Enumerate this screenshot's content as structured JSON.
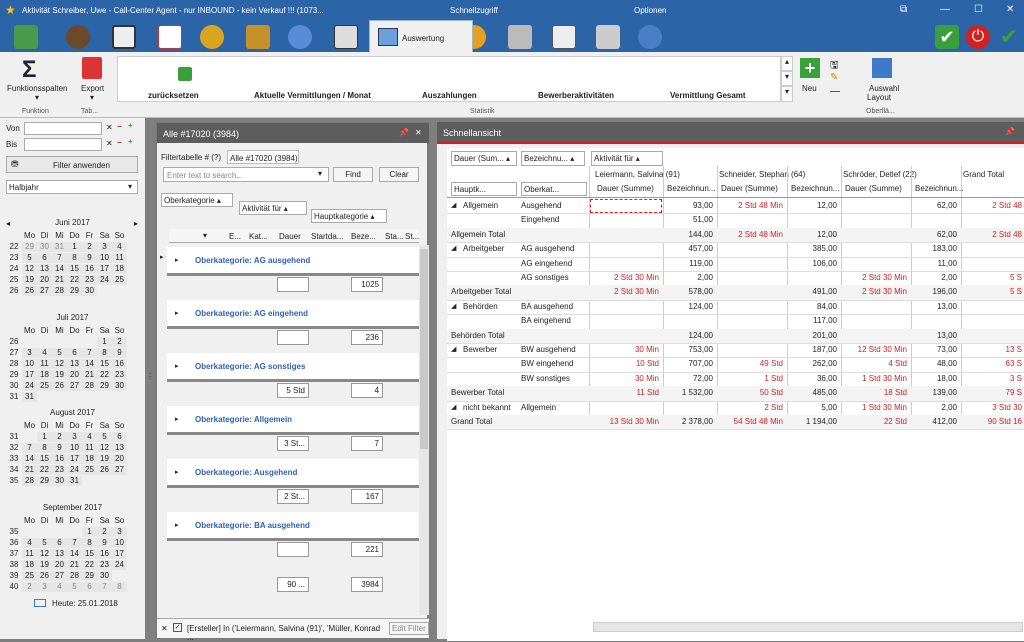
{
  "titlebar": {
    "title": "Aktivität Schreiber, Uwe - Call-Center Agent - nur INBOUND - kein Verkauf !!! (1073...",
    "quick_access": "Schnellzugriff",
    "options": "Optionen"
  },
  "main_tab": {
    "label": "Auswertung"
  },
  "ribbon": {
    "funktionsspalten": "Funktionsspalten",
    "funktion_group": "Funktion",
    "export": "Export",
    "tab_group": "Tab...",
    "gallery_items": [
      "zurücksetzen",
      "Aktuelle Vermittlungen / Monat",
      "Auszahlungen",
      "Bewerberaktivitäten",
      "Vermittlung Gesamt"
    ],
    "statistik_group": "Statistik",
    "neu": "Neu",
    "auswahl_layout": "Auswahl",
    "auswahl_layout2": "Layout",
    "oberflaeche_group": "Oberflä..."
  },
  "left": {
    "von": "Von",
    "bis": "Bis",
    "filter_button": "Filter anwenden",
    "period": "Halbjahr",
    "weekday_headers": [
      "Mo",
      "Di",
      "Mi",
      "Do",
      "Fr",
      "Sa",
      "So"
    ],
    "today_label": "Heute: 25.01.2018",
    "months": [
      {
        "title": "Juni 2017",
        "rows": [
          [
            "22",
            "29",
            "30",
            "31",
            "1",
            "2",
            "3",
            "4"
          ],
          [
            "23",
            "5",
            "6",
            "7",
            "8",
            "9",
            "10",
            "11"
          ],
          [
            "24",
            "12",
            "13",
            "14",
            "15",
            "16",
            "17",
            "18"
          ],
          [
            "25",
            "19",
            "20",
            "21",
            "22",
            "23",
            "24",
            "25"
          ],
          [
            "26",
            "26",
            "27",
            "28",
            "29",
            "30",
            "",
            ""
          ]
        ]
      },
      {
        "title": "Juli 2017",
        "rows": [
          [
            "26",
            "",
            "",
            "",
            "",
            "",
            "1",
            "2"
          ],
          [
            "27",
            "3",
            "4",
            "5",
            "6",
            "7",
            "8",
            "9"
          ],
          [
            "28",
            "10",
            "11",
            "12",
            "13",
            "14",
            "15",
            "16"
          ],
          [
            "29",
            "17",
            "18",
            "19",
            "20",
            "21",
            "22",
            "23"
          ],
          [
            "30",
            "24",
            "25",
            "26",
            "27",
            "28",
            "29",
            "30"
          ],
          [
            "31",
            "31",
            "",
            "",
            "",
            "",
            "",
            ""
          ]
        ]
      },
      {
        "title": "August 2017",
        "rows": [
          [
            "31",
            "",
            "1",
            "2",
            "3",
            "4",
            "5",
            "6"
          ],
          [
            "32",
            "7",
            "8",
            "9",
            "10",
            "11",
            "12",
            "13"
          ],
          [
            "33",
            "14",
            "15",
            "16",
            "17",
            "18",
            "19",
            "20"
          ],
          [
            "34",
            "21",
            "22",
            "23",
            "24",
            "25",
            "26",
            "27"
          ],
          [
            "35",
            "28",
            "29",
            "30",
            "31",
            "",
            "",
            ""
          ]
        ]
      },
      {
        "title": "September 2017",
        "rows": [
          [
            "35",
            "",
            "",
            "",
            "",
            "1",
            "2",
            "3"
          ],
          [
            "36",
            "4",
            "5",
            "6",
            "7",
            "8",
            "9",
            "10"
          ],
          [
            "37",
            "11",
            "12",
            "13",
            "14",
            "15",
            "16",
            "17"
          ],
          [
            "38",
            "18",
            "19",
            "20",
            "21",
            "22",
            "23",
            "24"
          ],
          [
            "39",
            "25",
            "26",
            "27",
            "28",
            "29",
            "30",
            ""
          ],
          [
            "40",
            "2",
            "3",
            "4",
            "5",
            "6",
            "7",
            "8"
          ]
        ]
      }
    ]
  },
  "grid": {
    "header": "Alle #17020 (3984)",
    "filter_label": "Filtertabelle # (?)",
    "filter_tab": "Alle #17020 (3984)",
    "search_placeholder": "Enter text to search...",
    "find": "Find",
    "clear": "Clear",
    "group_chips": [
      "Oberkategorie",
      "Aktivität für",
      "Hauptkategorie"
    ],
    "columns": [
      "E...",
      "Kat...",
      "Dauer",
      "Startda...",
      "Beze...",
      "Sta...",
      "St..."
    ],
    "groups": [
      {
        "label": "Oberkategorie: AG ausgehend",
        "dauer": "",
        "count": "1025"
      },
      {
        "label": "Oberkategorie: AG eingehend",
        "dauer": "",
        "count": "236"
      },
      {
        "label": "Oberkategorie: AG sonstiges",
        "dauer": "5 Std",
        "count": "4"
      },
      {
        "label": "Oberkategorie: Allgemein",
        "dauer": "3 St...",
        "count": "7"
      },
      {
        "label": "Oberkategorie: Ausgehend",
        "dauer": "2 St...",
        "count": "167"
      },
      {
        "label": "Oberkategorie: BA ausgehend",
        "dauer": "",
        "count": "221"
      }
    ],
    "total_dauer": "90 ...",
    "total_count": "3984",
    "filter_text": "[Ersteller] In ('Leiermann, Salvina (91)', 'Müller, Konrad ...",
    "edit_filter": "Edit Filter"
  },
  "quick": {
    "header": "Schnellansicht",
    "filter_chips": [
      "Dauer (Sum...",
      "Bezeichnu...",
      "Aktivität für"
    ],
    "row_chips": [
      "Hauptk...",
      "Oberkat..."
    ],
    "col_groups": [
      "Leiermann, Salvina (91)",
      "Schneider, Stephan (64)",
      "Schröder, Detlef (22)",
      "Grand Total"
    ],
    "sub_cols": [
      "Dauer (Summe)",
      "Bezeichnun..."
    ],
    "rows": [
      {
        "h": "Allgemein",
        "o": "Ausgehend",
        "c": [
          "",
          "93,00",
          "2 Std 48 Min",
          "12,00",
          "",
          "62,00",
          "2 Std 48"
        ],
        "exp": true
      },
      {
        "h": "",
        "o": "Eingehend",
        "c": [
          "",
          "51,00",
          "",
          "",
          "",
          "",
          ""
        ]
      },
      {
        "h": "Allgemein Total",
        "o": "",
        "c": [
          "",
          "144,00",
          "2 Std 48 Min",
          "12,00",
          "",
          "62,00",
          "2 Std 48"
        ],
        "total": true
      },
      {
        "h": "Arbeitgeber",
        "o": "AG ausgehend",
        "c": [
          "",
          "457,00",
          "",
          "385,00",
          "",
          "183,00",
          ""
        ],
        "exp": true
      },
      {
        "h": "",
        "o": "AG eingehend",
        "c": [
          "",
          "119,00",
          "",
          "106,00",
          "",
          "11,00",
          ""
        ]
      },
      {
        "h": "",
        "o": "AG sonstiges",
        "c": [
          "2 Std 30 Min",
          "2,00",
          "",
          "",
          "2 Std 30 Min",
          "2,00",
          "5 S"
        ]
      },
      {
        "h": "Arbeitgeber Total",
        "o": "",
        "c": [
          "2 Std 30 Min",
          "578,00",
          "",
          "491,00",
          "2 Std 30 Min",
          "196,00",
          "5 S"
        ],
        "total": true
      },
      {
        "h": "Behörden",
        "o": "BA ausgehend",
        "c": [
          "",
          "124,00",
          "",
          "84,00",
          "",
          "13,00",
          ""
        ],
        "exp": true
      },
      {
        "h": "",
        "o": "BA eingehend",
        "c": [
          "",
          "",
          "",
          "117,00",
          "",
          "",
          ""
        ]
      },
      {
        "h": "Behörden Total",
        "o": "",
        "c": [
          "",
          "124,00",
          "",
          "201,00",
          "",
          "13,00",
          ""
        ],
        "total": true
      },
      {
        "h": "Bewerber",
        "o": "BW ausgehend",
        "c": [
          "30 Min",
          "753,00",
          "",
          "187,00",
          "12 Std 30 Min",
          "73,00",
          "13 S"
        ],
        "exp": true
      },
      {
        "h": "",
        "o": "BW eingehend",
        "c": [
          "10 Std",
          "707,00",
          "49 Std",
          "262,00",
          "4 Std",
          "48,00",
          "63 S"
        ]
      },
      {
        "h": "",
        "o": "BW sonstiges",
        "c": [
          "30 Min",
          "72,00",
          "1 Std",
          "36,00",
          "1 Std 30 Min",
          "18,00",
          "3 S"
        ]
      },
      {
        "h": "Bewerber Total",
        "o": "",
        "c": [
          "11 Std",
          "1 532,00",
          "50 Std",
          "485,00",
          "18 Std",
          "139,00",
          "79 S"
        ],
        "total": true
      },
      {
        "h": "nicht bekannt",
        "o": "Allgemein",
        "c": [
          "",
          "",
          "2 Std",
          "5,00",
          "1 Std 30 Min",
          "2,00",
          "3 Std 30"
        ],
        "exp": true
      },
      {
        "h": "Grand Total",
        "o": "",
        "c": [
          "13 Std 30 Min",
          "2 378,00",
          "54 Std 48 Min",
          "1 194,00",
          "22 Std",
          "412,00",
          "90 Std 16"
        ],
        "total": true
      }
    ]
  }
}
